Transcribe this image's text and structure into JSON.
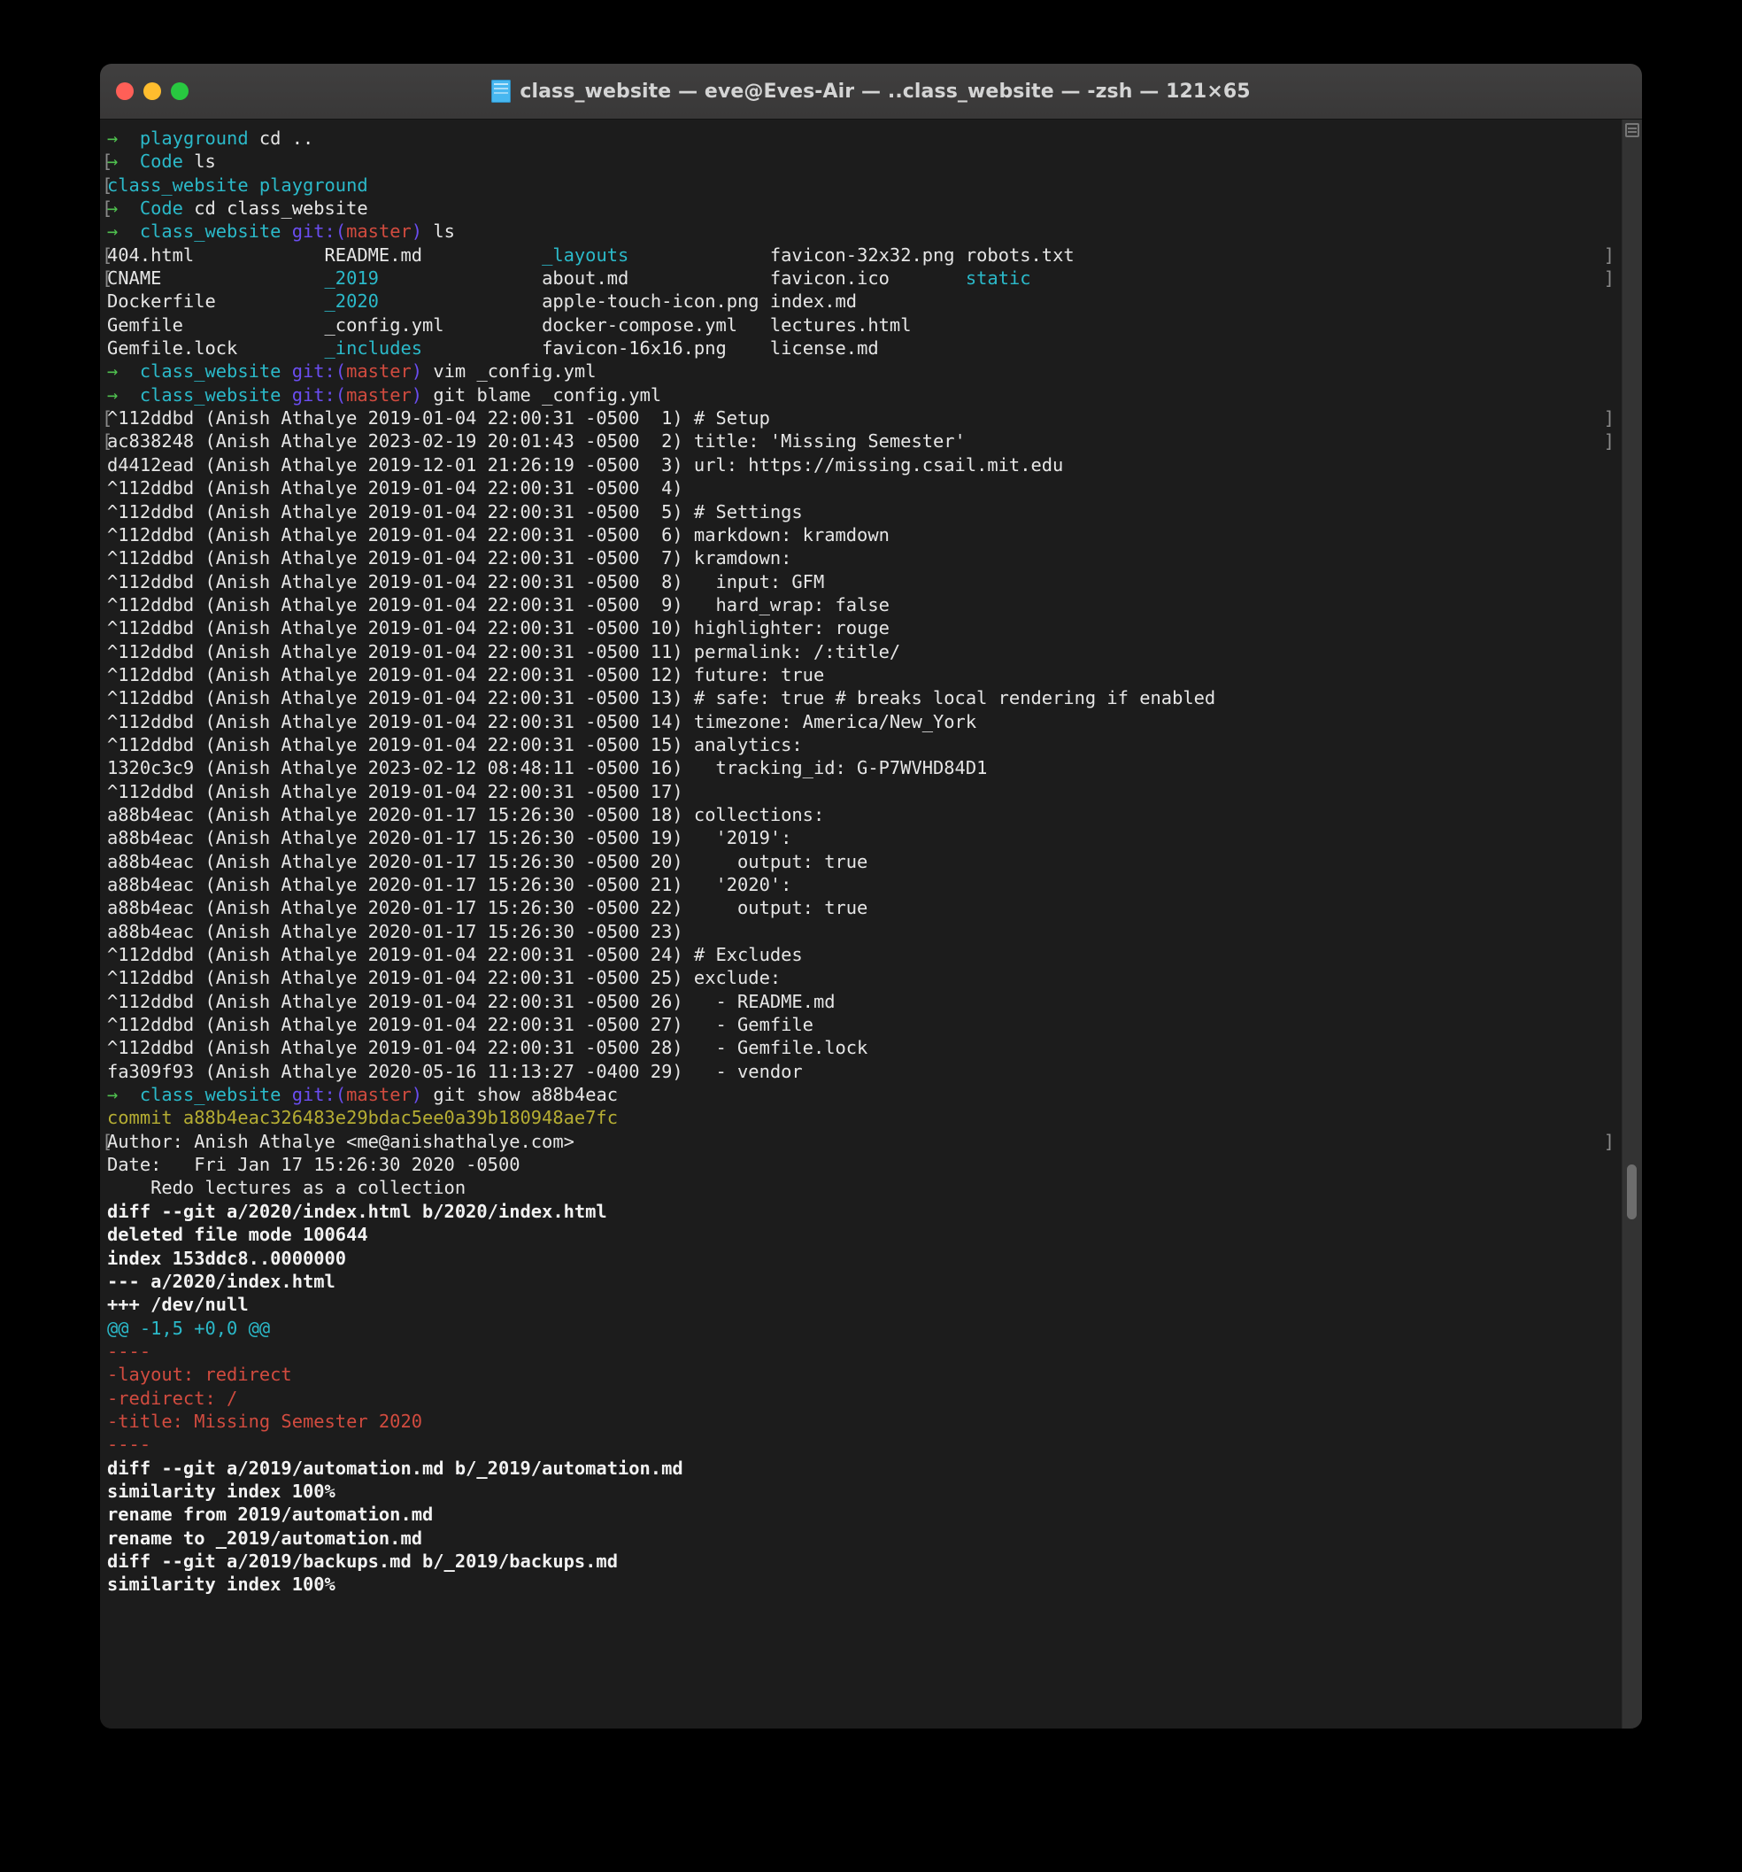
{
  "window": {
    "title": "class_website — eve@Eves-Air — ..class_website — -zsh — 121×65",
    "icon": "folder-file-icon",
    "traffic": {
      "close": "close-button",
      "minimize": "minimize-button",
      "zoom": "zoom-button"
    }
  },
  "colors": {
    "background": "#1c1c1c",
    "foreground": "#d9d9d9",
    "cyan": "#2bb9c9",
    "green": "#4fc14f",
    "red": "#d14b3f",
    "purple": "#6a4df0",
    "yellow": "#b5ad33",
    "titlebar": "#3c3b3b"
  },
  "prompt": {
    "arrow": "→",
    "git_prefix": "git:(",
    "branch": "master",
    "git_suffix": ")"
  },
  "terminal": {
    "lines": [
      {
        "t": "prompt",
        "dir": "playground",
        "git": false,
        "cmd": "cd .."
      },
      {
        "t": "prompt",
        "dir": "Code",
        "git": false,
        "cmd": "ls",
        "lbracket": true
      },
      {
        "t": "lsrow",
        "cols": [
          {
            "v": "class_website",
            "c": "cyan"
          },
          {
            "v": "playground",
            "c": "cyan"
          }
        ],
        "raw": "class_website playground",
        "lbracket": true
      },
      {
        "t": "prompt",
        "dir": "Code",
        "git": false,
        "cmd": "cd class_website",
        "lbracket": true
      },
      {
        "t": "prompt",
        "dir": "class_website",
        "git": true,
        "cmd": "ls"
      },
      {
        "t": "ls",
        "cells": [
          {
            "v": "404.html",
            "c": "white"
          },
          {
            "v": "README.md",
            "c": "white"
          },
          {
            "v": "_layouts",
            "c": "cyan"
          },
          {
            "v": "favicon-32x32.png",
            "c": "white"
          },
          {
            "v": "robots.txt",
            "c": "white"
          }
        ],
        "lbracket": true,
        "rbracket": true
      },
      {
        "t": "ls",
        "cells": [
          {
            "v": "CNAME",
            "c": "white"
          },
          {
            "v": "_2019",
            "c": "cyan"
          },
          {
            "v": "about.md",
            "c": "white"
          },
          {
            "v": "favicon.ico",
            "c": "white"
          },
          {
            "v": "static",
            "c": "cyan"
          }
        ],
        "lbracket": true,
        "rbracket": true
      },
      {
        "t": "ls",
        "cells": [
          {
            "v": "Dockerfile",
            "c": "white"
          },
          {
            "v": "_2020",
            "c": "cyan"
          },
          {
            "v": "apple-touch-icon.png",
            "c": "white"
          },
          {
            "v": "index.md",
            "c": "white"
          },
          {
            "v": "",
            "c": "white"
          }
        ]
      },
      {
        "t": "ls",
        "cells": [
          {
            "v": "Gemfile",
            "c": "white"
          },
          {
            "v": "_config.yml",
            "c": "white"
          },
          {
            "v": "docker-compose.yml",
            "c": "white"
          },
          {
            "v": "lectures.html",
            "c": "white"
          },
          {
            "v": "",
            "c": "white"
          }
        ]
      },
      {
        "t": "ls",
        "cells": [
          {
            "v": "Gemfile.lock",
            "c": "white"
          },
          {
            "v": "_includes",
            "c": "cyan"
          },
          {
            "v": "favicon-16x16.png",
            "c": "white"
          },
          {
            "v": "license.md",
            "c": "white"
          },
          {
            "v": "",
            "c": "white"
          }
        ]
      },
      {
        "t": "prompt",
        "dir": "class_website",
        "git": true,
        "cmd": "vim _config.yml"
      },
      {
        "t": "prompt",
        "dir": "class_website",
        "git": true,
        "cmd": "git blame _config.yml"
      },
      {
        "t": "blame",
        "hash": "^112ddbd",
        "author": "Anish Athalye",
        "date": "2019-01-04 22:00:31 -0500",
        "num": " 1",
        "code": "# Setup",
        "lbracket": true,
        "rbracket": true
      },
      {
        "t": "blame",
        "hash": "ac838248",
        "author": "Anish Athalye",
        "date": "2023-02-19 20:01:43 -0500",
        "num": " 2",
        "code": "title: 'Missing Semester'",
        "lbracket": true,
        "rbracket": true
      },
      {
        "t": "blame",
        "hash": "d4412ead",
        "author": "Anish Athalye",
        "date": "2019-12-01 21:26:19 -0500",
        "num": " 3",
        "code": "url: https://missing.csail.mit.edu"
      },
      {
        "t": "blame",
        "hash": "^112ddbd",
        "author": "Anish Athalye",
        "date": "2019-01-04 22:00:31 -0500",
        "num": " 4",
        "code": ""
      },
      {
        "t": "blame",
        "hash": "^112ddbd",
        "author": "Anish Athalye",
        "date": "2019-01-04 22:00:31 -0500",
        "num": " 5",
        "code": "# Settings"
      },
      {
        "t": "blame",
        "hash": "^112ddbd",
        "author": "Anish Athalye",
        "date": "2019-01-04 22:00:31 -0500",
        "num": " 6",
        "code": "markdown: kramdown"
      },
      {
        "t": "blame",
        "hash": "^112ddbd",
        "author": "Anish Athalye",
        "date": "2019-01-04 22:00:31 -0500",
        "num": " 7",
        "code": "kramdown:"
      },
      {
        "t": "blame",
        "hash": "^112ddbd",
        "author": "Anish Athalye",
        "date": "2019-01-04 22:00:31 -0500",
        "num": " 8",
        "code": "  input: GFM"
      },
      {
        "t": "blame",
        "hash": "^112ddbd",
        "author": "Anish Athalye",
        "date": "2019-01-04 22:00:31 -0500",
        "num": " 9",
        "code": "  hard_wrap: false"
      },
      {
        "t": "blame",
        "hash": "^112ddbd",
        "author": "Anish Athalye",
        "date": "2019-01-04 22:00:31 -0500",
        "num": "10",
        "code": "highlighter: rouge"
      },
      {
        "t": "blame",
        "hash": "^112ddbd",
        "author": "Anish Athalye",
        "date": "2019-01-04 22:00:31 -0500",
        "num": "11",
        "code": "permalink: /:title/"
      },
      {
        "t": "blame",
        "hash": "^112ddbd",
        "author": "Anish Athalye",
        "date": "2019-01-04 22:00:31 -0500",
        "num": "12",
        "code": "future: true"
      },
      {
        "t": "blame",
        "hash": "^112ddbd",
        "author": "Anish Athalye",
        "date": "2019-01-04 22:00:31 -0500",
        "num": "13",
        "code": "# safe: true # breaks local rendering if enabled"
      },
      {
        "t": "blame",
        "hash": "^112ddbd",
        "author": "Anish Athalye",
        "date": "2019-01-04 22:00:31 -0500",
        "num": "14",
        "code": "timezone: America/New_York"
      },
      {
        "t": "blame",
        "hash": "^112ddbd",
        "author": "Anish Athalye",
        "date": "2019-01-04 22:00:31 -0500",
        "num": "15",
        "code": "analytics:"
      },
      {
        "t": "blame",
        "hash": "1320c3c9",
        "author": "Anish Athalye",
        "date": "2023-02-12 08:48:11 -0500",
        "num": "16",
        "code": "  tracking_id: G-P7WVHD84D1"
      },
      {
        "t": "blame",
        "hash": "^112ddbd",
        "author": "Anish Athalye",
        "date": "2019-01-04 22:00:31 -0500",
        "num": "17",
        "code": ""
      },
      {
        "t": "blame",
        "hash": "a88b4eac",
        "author": "Anish Athalye",
        "date": "2020-01-17 15:26:30 -0500",
        "num": "18",
        "code": "collections:"
      },
      {
        "t": "blame",
        "hash": "a88b4eac",
        "author": "Anish Athalye",
        "date": "2020-01-17 15:26:30 -0500",
        "num": "19",
        "code": "  '2019':"
      },
      {
        "t": "blame",
        "hash": "a88b4eac",
        "author": "Anish Athalye",
        "date": "2020-01-17 15:26:30 -0500",
        "num": "20",
        "code": "    output: true"
      },
      {
        "t": "blame",
        "hash": "a88b4eac",
        "author": "Anish Athalye",
        "date": "2020-01-17 15:26:30 -0500",
        "num": "21",
        "code": "  '2020':"
      },
      {
        "t": "blame",
        "hash": "a88b4eac",
        "author": "Anish Athalye",
        "date": "2020-01-17 15:26:30 -0500",
        "num": "22",
        "code": "    output: true"
      },
      {
        "t": "blame",
        "hash": "a88b4eac",
        "author": "Anish Athalye",
        "date": "2020-01-17 15:26:30 -0500",
        "num": "23",
        "code": ""
      },
      {
        "t": "blame",
        "hash": "^112ddbd",
        "author": "Anish Athalye",
        "date": "2019-01-04 22:00:31 -0500",
        "num": "24",
        "code": "# Excludes"
      },
      {
        "t": "blame",
        "hash": "^112ddbd",
        "author": "Anish Athalye",
        "date": "2019-01-04 22:00:31 -0500",
        "num": "25",
        "code": "exclude:"
      },
      {
        "t": "blame",
        "hash": "^112ddbd",
        "author": "Anish Athalye",
        "date": "2019-01-04 22:00:31 -0500",
        "num": "26",
        "code": "  - README.md"
      },
      {
        "t": "blame",
        "hash": "^112ddbd",
        "author": "Anish Athalye",
        "date": "2019-01-04 22:00:31 -0500",
        "num": "27",
        "code": "  - Gemfile"
      },
      {
        "t": "blame",
        "hash": "^112ddbd",
        "author": "Anish Athalye",
        "date": "2019-01-04 22:00:31 -0500",
        "num": "28",
        "code": "  - Gemfile.lock"
      },
      {
        "t": "blame",
        "hash": "fa309f93",
        "author": "Anish Athalye",
        "date": "2020-05-16 11:13:27 -0400",
        "num": "29",
        "code": "  - vendor"
      },
      {
        "t": "prompt",
        "dir": "class_website",
        "git": true,
        "cmd": "git show a88b4eac"
      },
      {
        "t": "plain",
        "text": "commit a88b4eac326483e29bdac5ee0a39b180948ae7fc",
        "c": "yellow"
      },
      {
        "t": "plain",
        "text": "Author: Anish Athalye <me@anishathalye.com>",
        "c": "white",
        "lbracket": true,
        "rbracket": true
      },
      {
        "t": "plain",
        "text": "Date:   Fri Jan 17 15:26:30 2020 -0500",
        "c": "white"
      },
      {
        "t": "plain",
        "text": "",
        "c": "white"
      },
      {
        "t": "plain",
        "text": "    Redo lectures as a collection",
        "c": "white"
      },
      {
        "t": "plain",
        "text": "",
        "c": "white"
      },
      {
        "t": "plain",
        "text": "diff --git a/2020/index.html b/2020/index.html",
        "c": "bold"
      },
      {
        "t": "plain",
        "text": "deleted file mode 100644",
        "c": "bold"
      },
      {
        "t": "plain",
        "text": "index 153ddc8..0000000",
        "c": "bold"
      },
      {
        "t": "plain",
        "text": "--- a/2020/index.html",
        "c": "bold"
      },
      {
        "t": "plain",
        "text": "+++ /dev/null",
        "c": "bold"
      },
      {
        "t": "plain",
        "text": "@@ -1,5 +0,0 @@",
        "c": "diffcy"
      },
      {
        "t": "plain",
        "text": "----",
        "c": "red"
      },
      {
        "t": "plain",
        "text": "-layout: redirect",
        "c": "red"
      },
      {
        "t": "plain",
        "text": "-redirect: /",
        "c": "red"
      },
      {
        "t": "plain",
        "text": "-title: Missing Semester 2020",
        "c": "red"
      },
      {
        "t": "plain",
        "text": "----",
        "c": "red"
      },
      {
        "t": "plain",
        "text": "diff --git a/2019/automation.md b/_2019/automation.md",
        "c": "bold"
      },
      {
        "t": "plain",
        "text": "similarity index 100%",
        "c": "bold"
      },
      {
        "t": "plain",
        "text": "rename from 2019/automation.md",
        "c": "bold"
      },
      {
        "t": "plain",
        "text": "rename to _2019/automation.md",
        "c": "bold"
      },
      {
        "t": "plain",
        "text": "diff --git a/2019/backups.md b/_2019/backups.md",
        "c": "bold"
      },
      {
        "t": "plain",
        "text": "similarity index 100%",
        "c": "bold"
      }
    ]
  },
  "scrollbar": {
    "indicator": "scroll-lines-icon",
    "thumb": "scroll-thumb"
  }
}
